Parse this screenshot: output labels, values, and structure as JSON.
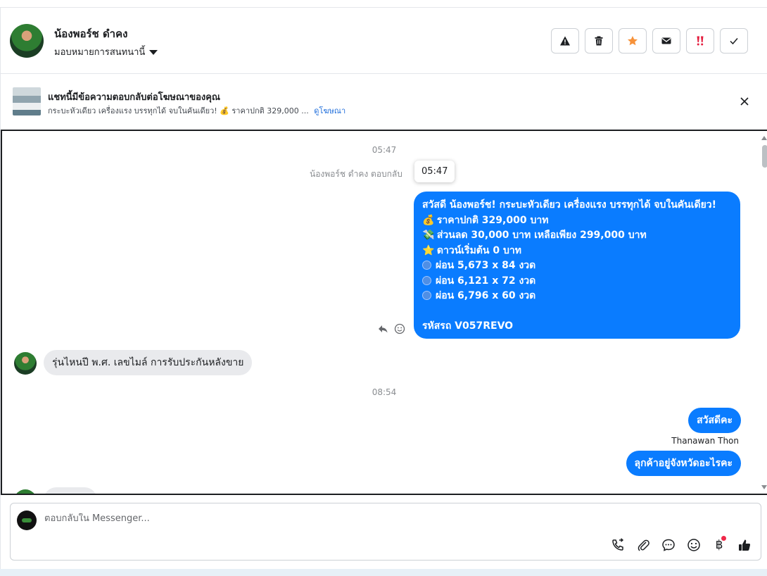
{
  "header": {
    "contact_name": "น้องพอร์ช ดำคง",
    "assign_label": "มอบหมายการสนทนานี้",
    "actions": [
      {
        "name": "spam-button",
        "icon": "warning-icon",
        "color": "#1c1e21"
      },
      {
        "name": "delete-button",
        "icon": "trash-icon",
        "color": "#1c1e21"
      },
      {
        "name": "star-button",
        "icon": "star-icon",
        "color": "#f7923a"
      },
      {
        "name": "mark-unread-button",
        "icon": "envelope-icon",
        "color": "#1c1e21"
      },
      {
        "name": "follow-up-button",
        "icon": "double-exclamation-icon",
        "color": "#e41e3f"
      },
      {
        "name": "mark-done-button",
        "icon": "check-icon",
        "color": "#1c1e21"
      }
    ]
  },
  "banner": {
    "title": "แชทนี้มีข้อความตอบกลับต่อโฆษณาของคุณ",
    "subtitle": "กระบะหัวเดียว เครื่องแรง บรรทุกได้ จบในคันเดียว! 💰 ราคาปกติ 329,000 ...",
    "link": "ดูโฆษณา"
  },
  "chat": {
    "time_1": "05:47",
    "reply_note": "น้องพอร์ช ดำคง ตอบกลับ",
    "tooltip_time": "05:47",
    "ad_message": {
      "lines": [
        {
          "emoji": "",
          "text": "สวัสดี น้องพอร์ช! กระบะหัวเดียว เครื่องแรง บรรทุกได้ จบในคันเดียว!"
        },
        {
          "emoji": "💰",
          "text": "ราคาปกติ 329,000 บาท"
        },
        {
          "emoji": "💸",
          "text": "ส่วนลด 30,000 บาท เหลือเพียง 299,000 บาท"
        },
        {
          "emoji": "⭐",
          "text": "ดาวน์เริ่มต้น 0 บาท"
        },
        {
          "emoji": "circle",
          "text": "ผ่อน 5,673 x 84 งวด"
        },
        {
          "emoji": "circle",
          "text": "ผ่อน 6,121 x 72 งวด"
        },
        {
          "emoji": "circle",
          "text": "ผ่อน 6,796 x 60 งวด"
        },
        {
          "emoji": "",
          "text": ""
        },
        {
          "emoji": "",
          "text": "รหัสรถ V057REVO"
        }
      ]
    },
    "incoming_1": "รุ่นไหนปี พ.ศ.  เลขไมล์  การรับประกันหลังขาย",
    "time_2": "08:54",
    "outgoing_1": "สวัสดีคะ",
    "sender_name": "Thanawan Thon",
    "outgoing_2": "ลุกค้าอยู่จังหวัดอะไรคะ"
  },
  "composer": {
    "placeholder": "ตอบกลับใน Messenger...",
    "tools": [
      "phone-forward-icon",
      "paperclip-icon",
      "chat-bubble-icon",
      "smiley-icon",
      "baht-icon",
      "thumbs-up-icon"
    ],
    "baht_symbol": "฿"
  },
  "colors": {
    "accent": "#0a7cff",
    "incoming_bubble": "#e9eaed",
    "link": "#216fdb"
  }
}
